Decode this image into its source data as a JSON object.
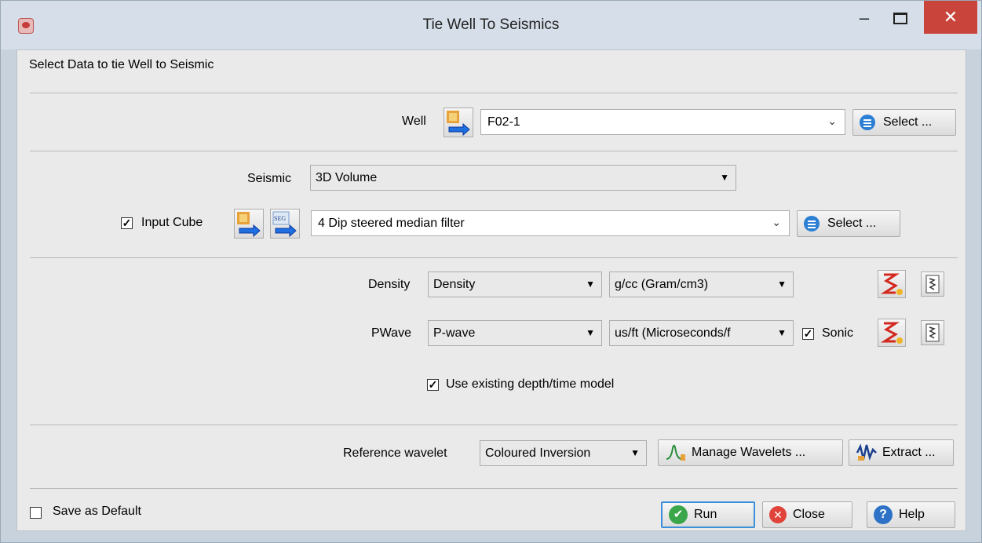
{
  "window": {
    "title": "Tie Well To Seismics"
  },
  "header": {
    "text": "Select Data to tie Well to Seismic"
  },
  "well": {
    "label": "Well",
    "value": "F02-1",
    "select_label": "Select ..."
  },
  "seismic": {
    "label": "Seismic",
    "value": "3D Volume"
  },
  "input_cube": {
    "label": "Input Cube",
    "checked": true,
    "value": "4 Dip steered median filter",
    "select_label": "Select ...",
    "seg_label": "SEG"
  },
  "density": {
    "label": "Density",
    "log": "Density",
    "unit": "g/cc (Gram/cm3)"
  },
  "pwave": {
    "label": "PWave",
    "log": "P-wave",
    "unit": "us/ft (Microseconds/f",
    "sonic_label": "Sonic",
    "sonic_checked": true
  },
  "use_existing": {
    "label": "Use existing depth/time model",
    "checked": true
  },
  "wavelet": {
    "label": "Reference wavelet",
    "value": "Coloured Inversion",
    "manage_label": "Manage Wavelets ...",
    "extract_label": "Extract ..."
  },
  "footer": {
    "save_default_label": "Save as Default",
    "save_default_checked": false,
    "run_label": "Run",
    "close_label": "Close",
    "help_label": "Help"
  },
  "colors": {
    "titlebar": "#d6dfe9",
    "close_button": "#c9443a",
    "client_bg": "#eaeaea",
    "accent": "#3c8fd9"
  },
  "check_glyph": "✓"
}
